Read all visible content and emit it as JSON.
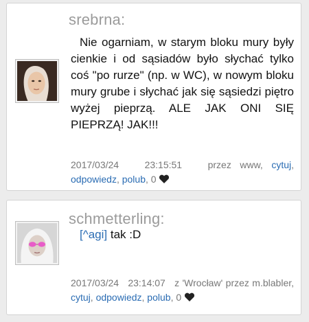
{
  "posts": [
    {
      "author": "srebrna:",
      "text": "Nie ogarniam, w starym bloku mury były cienkie i od sąsiadów było słychać tylko coś \"po rurze\" (np. w WC), w nowym bloku mury grube i słychać jak się sąsiedzi piętro wyżej pieprzą. ALE JAK ONI SIĘ PIEPRZĄ! JAK!!!",
      "date": "2017/03/24",
      "time": "23:15:51",
      "via": "przez www,",
      "cytuj": "cytuj",
      "odpowiedz": "odpowiedz",
      "polub": "polub",
      "likes": "0"
    },
    {
      "author": "schmetterling:",
      "reply_to": "[^agi]",
      "text": "tak :D",
      "date": "2017/03/24",
      "time": "23:14:07",
      "via": "z 'Wrocław' przez m.blabler,",
      "cytuj": "cytuj",
      "odpowiedz": "odpowiedz",
      "polub": "polub",
      "likes": "0"
    }
  ]
}
